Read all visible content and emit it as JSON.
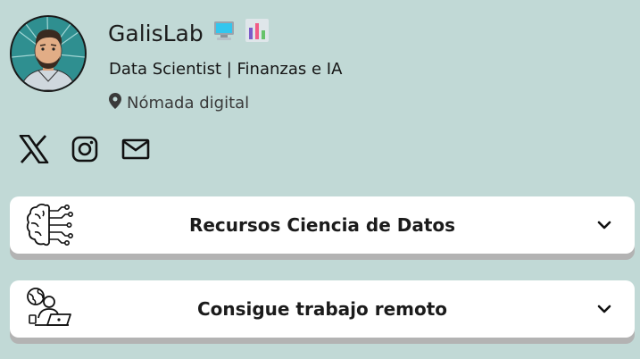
{
  "profile": {
    "name": "GalisLab",
    "name_emojis": [
      "computer-icon",
      "bar-chart-icon"
    ],
    "bio": "Data Scientist | Finanzas e IA",
    "location": "Nómada digital"
  },
  "social": [
    {
      "icon": "x-twitter-icon"
    },
    {
      "icon": "instagram-icon"
    },
    {
      "icon": "email-icon"
    }
  ],
  "cards": [
    {
      "title": "Recursos Ciencia de Datos",
      "icon": "brain-circuit-icon"
    },
    {
      "title": "Consigue trabajo remoto",
      "icon": "remote-worker-icon"
    }
  ],
  "colors": {
    "background": "#c1d9d6",
    "card": "#ffffff",
    "card_shadow": "#b3b3b3",
    "text": "#1b1b1b"
  }
}
